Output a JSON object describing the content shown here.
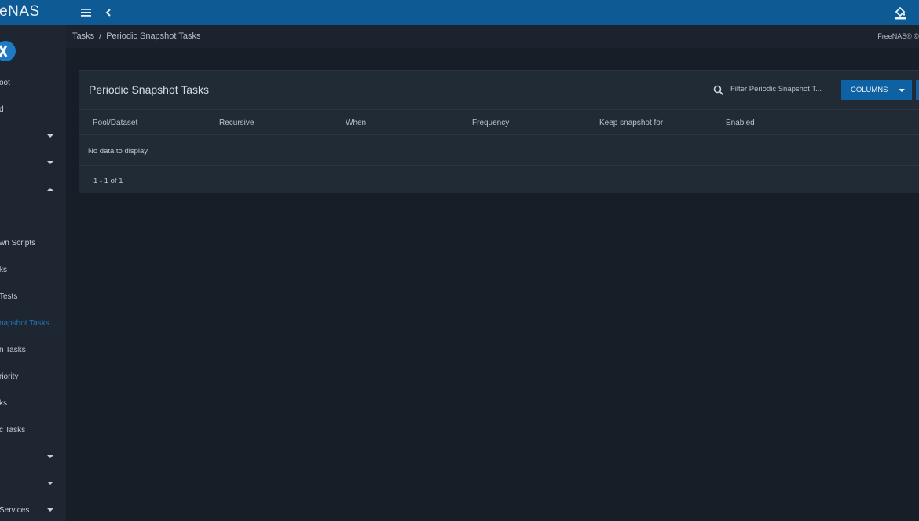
{
  "app": {
    "brand": "eeNAS",
    "colors": {
      "topbar": "#0d5a94",
      "accent": "#1e7ac2",
      "background": "#171e28",
      "card": "#212b36"
    }
  },
  "topbar": {
    "menu_icon": "hamburger-icon",
    "back_icon": "chevron-left-icon",
    "theme_icon": "paint-bucket-icon"
  },
  "breadcrumb": {
    "items": [
      "Tasks",
      "Periodic Snapshot Tasks"
    ],
    "separator": "/",
    "version": "FreeNAS® ©"
  },
  "sidebar": {
    "items": [
      {
        "label": "oot",
        "caret": ""
      },
      {
        "label": "d",
        "caret": ""
      },
      {
        "label": "",
        "caret": "down"
      },
      {
        "label": "",
        "caret": "down"
      },
      {
        "label": "",
        "caret": "up"
      },
      {
        "label": "wn Scripts",
        "caret": ""
      },
      {
        "label": "ks",
        "caret": ""
      },
      {
        "label": " Tests",
        "caret": ""
      },
      {
        "label": "napshot Tasks",
        "caret": "",
        "active": true
      },
      {
        "label": "n Tasks",
        "caret": ""
      },
      {
        "label": "riority",
        "caret": ""
      },
      {
        "label": "ks",
        "caret": ""
      },
      {
        "label": "c Tasks",
        "caret": ""
      },
      {
        "label": "",
        "caret": "down"
      },
      {
        "label": "",
        "caret": "down"
      },
      {
        "label": "Services",
        "caret": "down"
      }
    ]
  },
  "card": {
    "title": "Periodic Snapshot Tasks",
    "filter_placeholder": "Filter Periodic Snapshot T...",
    "columns_label": "COLUMNS",
    "headers": [
      "Pool/Dataset",
      "Recursive",
      "When",
      "Frequency",
      "Keep snapshot for",
      "Enabled"
    ],
    "empty_text": "No data to display",
    "pager": "1 - 1 of 1"
  }
}
